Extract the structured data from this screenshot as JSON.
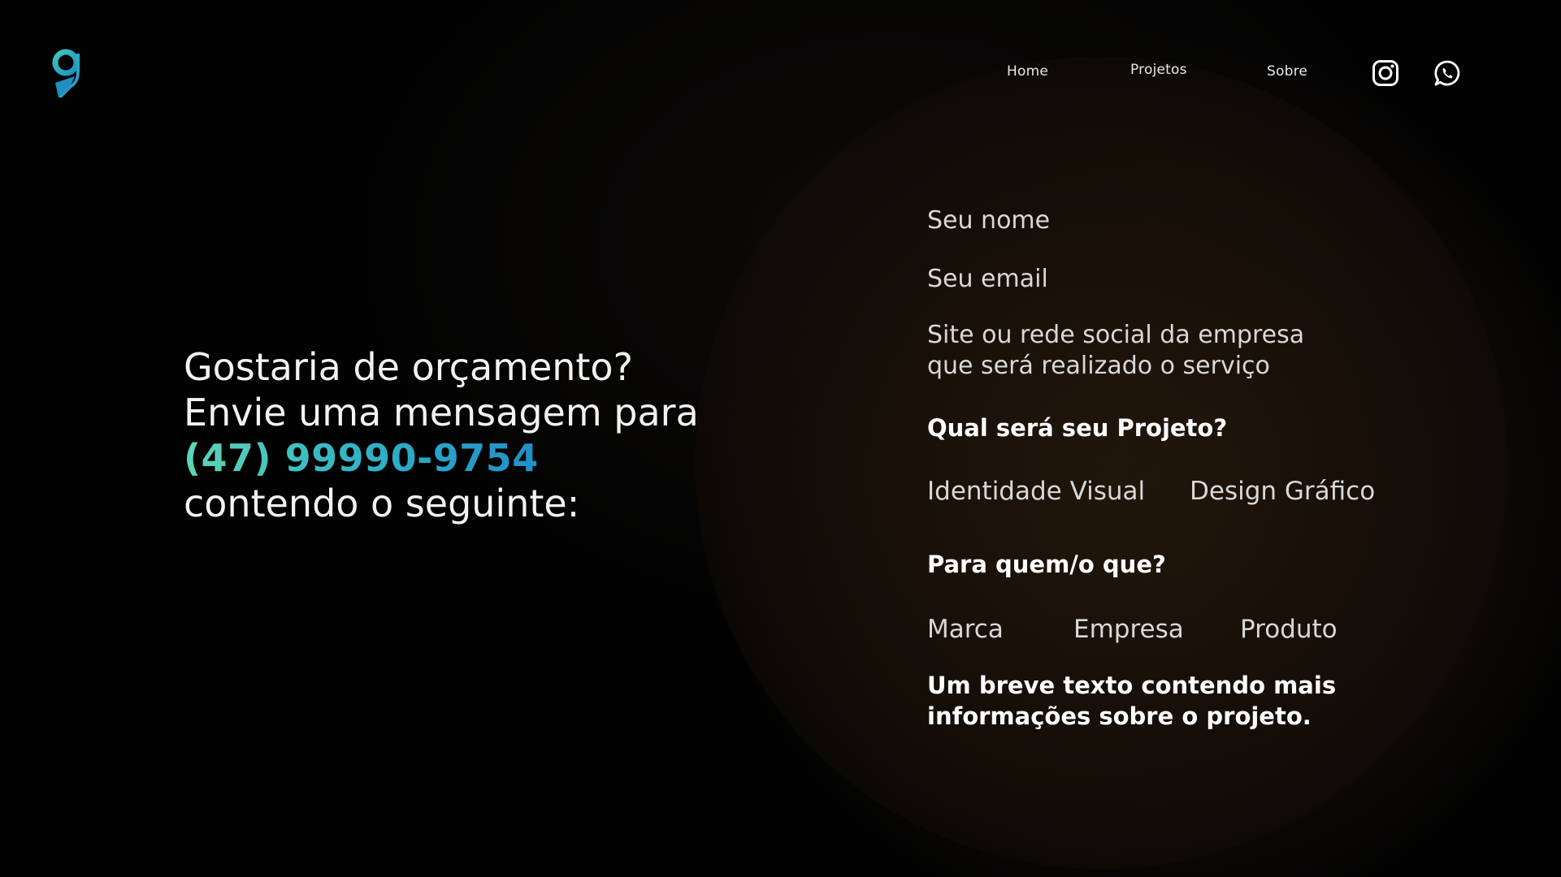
{
  "header": {
    "nav": [
      {
        "label": "Home"
      },
      {
        "label": "Projetos"
      },
      {
        "label": "Sobre"
      }
    ],
    "social": [
      {
        "icon": "instagram-icon"
      },
      {
        "icon": "whatsapp-icon"
      }
    ],
    "logo_icon": "g-logo-icon"
  },
  "intro": {
    "line1": "Gostaria de orçamento?",
    "line2": "Envie uma mensagem para",
    "phone": "(47) 99990-9754",
    "line4": "contendo o seguinte:"
  },
  "form": {
    "name_label": "Seu nome",
    "email_label": "Seu email",
    "site_label_line1": "Site ou rede social da empresa",
    "site_label_line2": "que será realizado o serviço",
    "project_question": "Qual será seu Projeto?",
    "project_options": [
      "Identidade Visual",
      "Design Gráfico"
    ],
    "target_question": "Para quem/o que?",
    "target_options": [
      "Marca",
      "Empresa",
      "Produto"
    ],
    "brief_line1": "Um breve texto contendo mais",
    "brief_line2": "informações sobre o projeto."
  },
  "colors": {
    "accent_start": "#5fd6b5",
    "accent_end": "#1e8fc9",
    "background": "#020202"
  }
}
